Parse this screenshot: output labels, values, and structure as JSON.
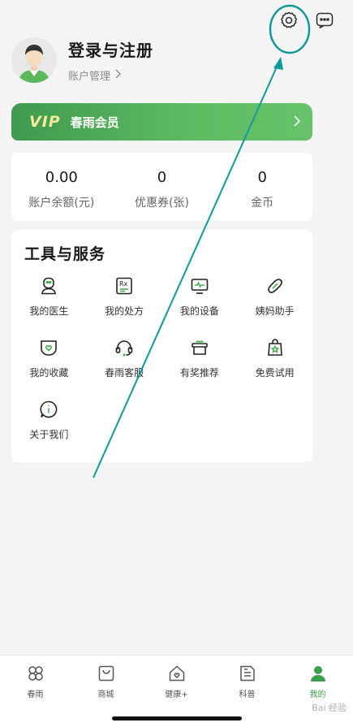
{
  "header": {
    "settings_icon": "gear-icon",
    "message_icon": "chat-bubble-icon"
  },
  "profile": {
    "title": "登录与注册",
    "subtitle": "账户管理",
    "subtitle_arrow": "chevron-right-icon"
  },
  "vip": {
    "logo": "VIP",
    "label": "春雨会员",
    "arrow": "chevron-right-icon",
    "color": "#4caf50"
  },
  "stats": [
    {
      "value": "0.00",
      "label": "账户余额(元)"
    },
    {
      "value": "0",
      "label": "优惠券(张)"
    },
    {
      "value": "0",
      "label": "金币"
    }
  ],
  "tools": {
    "title": "工具与服务",
    "items": [
      {
        "label": "我的医生",
        "icon": "doctor-icon"
      },
      {
        "label": "我的处方",
        "icon": "prescription-icon"
      },
      {
        "label": "我的设备",
        "icon": "monitor-icon"
      },
      {
        "label": "姨妈助手",
        "icon": "pad-icon"
      },
      {
        "label": "我的收藏",
        "icon": "favorite-icon"
      },
      {
        "label": "春雨客服",
        "icon": "headset-icon"
      },
      {
        "label": "有奖推荐",
        "icon": "gift-icon"
      },
      {
        "label": "免费试用",
        "icon": "trial-bag-icon"
      },
      {
        "label": "关于我们",
        "icon": "info-icon"
      }
    ]
  },
  "tabbar": {
    "tabs": [
      {
        "label": "春雨",
        "icon": "clover-icon",
        "active": false
      },
      {
        "label": "商城",
        "icon": "shopping-bag-icon",
        "active": false
      },
      {
        "label": "健康+",
        "icon": "health-home-icon",
        "active": false
      },
      {
        "label": "科普",
        "icon": "article-icon",
        "active": false
      },
      {
        "label": "我的",
        "icon": "user-icon",
        "active": true
      }
    ],
    "active_color": "#3aa04a"
  },
  "watermark": "Bai 经验"
}
